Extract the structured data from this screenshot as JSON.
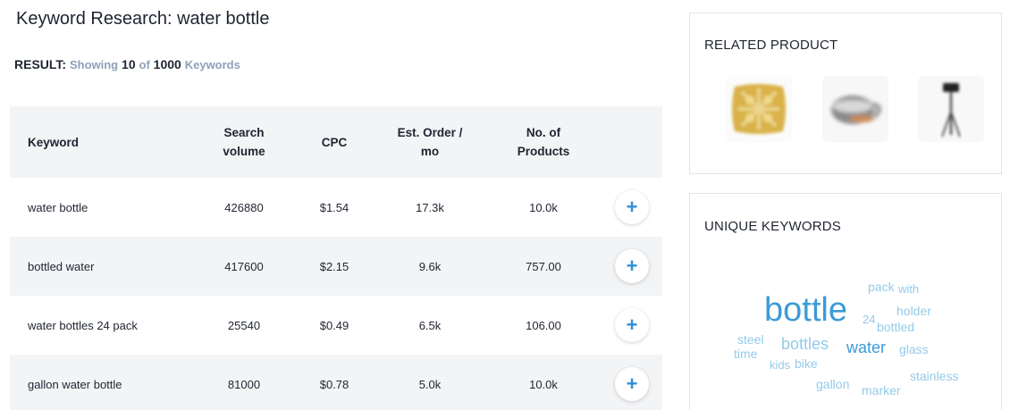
{
  "header": {
    "title": "Keyword Research: water bottle"
  },
  "result": {
    "label": "RESULT:",
    "showing": "Showing",
    "count": "10",
    "of": "of",
    "total": "1000",
    "unit": "Keywords"
  },
  "table": {
    "headers": {
      "keyword": "Keyword",
      "search_volume_1": "Search",
      "search_volume_2": "volume",
      "cpc": "CPC",
      "est_order_1": "Est. Order /",
      "est_order_2": "mo",
      "products_1": "No. of",
      "products_2": "Products"
    },
    "rows": [
      {
        "keyword": "water bottle",
        "search_volume": "426880",
        "cpc": "$1.54",
        "est_order": "17.3k",
        "products": "10.0k"
      },
      {
        "keyword": "bottled water",
        "search_volume": "417600",
        "cpc": "$2.15",
        "est_order": "9.6k",
        "products": "757.00"
      },
      {
        "keyword": "water bottles 24 pack",
        "search_volume": "25540",
        "cpc": "$0.49",
        "est_order": "6.5k",
        "products": "106.00"
      },
      {
        "keyword": "gallon water bottle",
        "search_volume": "81000",
        "cpc": "$0.78",
        "est_order": "5.0k",
        "products": "10.0k"
      }
    ],
    "add_icon": "+"
  },
  "related": {
    "title": "RELATED PRODUCT",
    "products": [
      "pillow-thumbnail",
      "mug-thumbnail",
      "lamp-thumbnail"
    ]
  },
  "unique": {
    "title": "UNIQUE KEYWORDS",
    "words": [
      "pack",
      "with",
      "bottle",
      "holder",
      "24",
      "bottled",
      "steel",
      "bottles",
      "water",
      "glass",
      "time",
      "kids",
      "bike",
      "stainless",
      "gallon",
      "marker"
    ]
  },
  "colors": {
    "accent": "#2e8fd8",
    "muted": "#8fa0b8",
    "row_alt": "#f3f4f6",
    "cloud_dark": "#3b9bd6",
    "cloud_light": "#93cbe8"
  }
}
